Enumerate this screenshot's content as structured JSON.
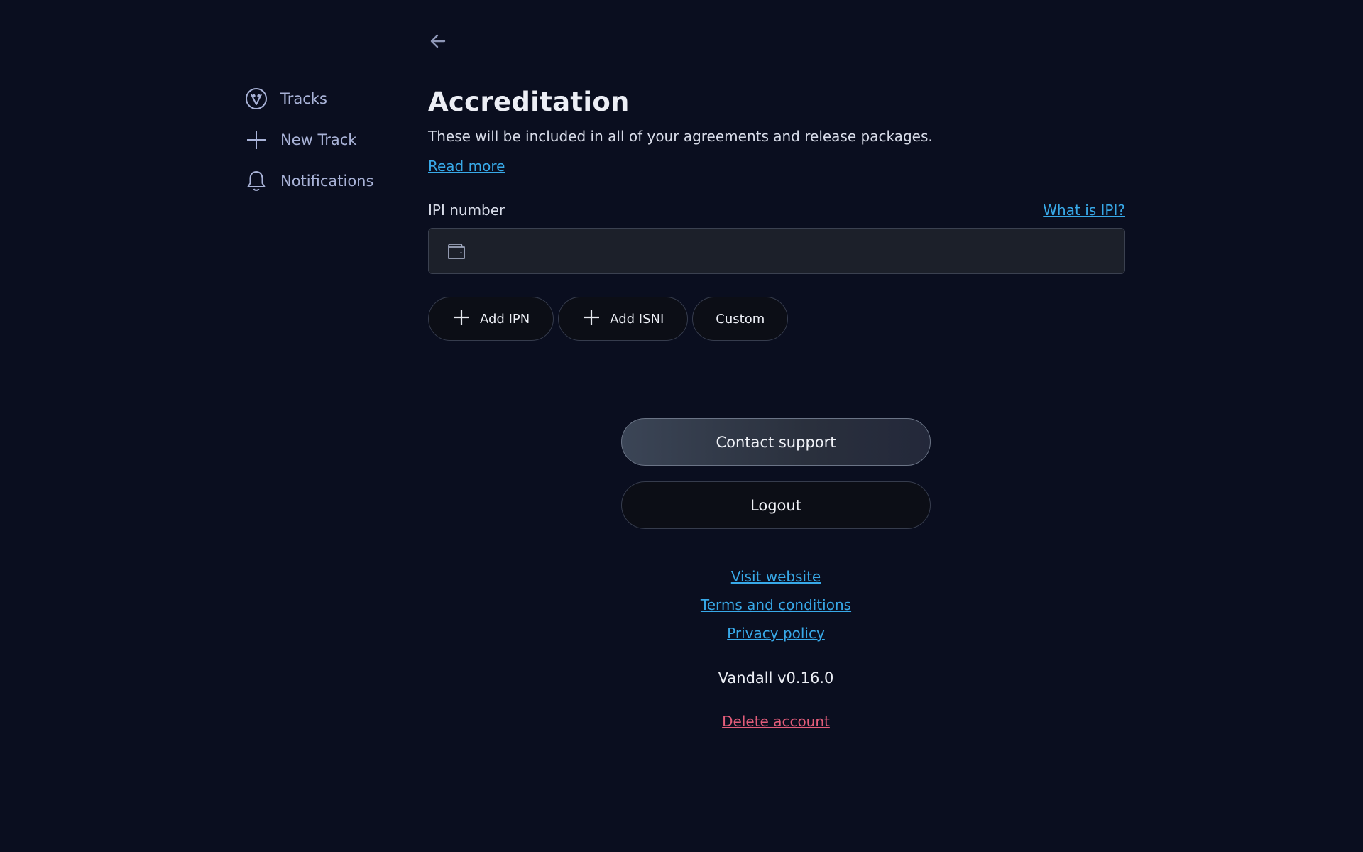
{
  "sidebar": {
    "items": [
      {
        "label": "Tracks",
        "icon": "vandall-logo-icon"
      },
      {
        "label": "New Track",
        "icon": "plus-icon"
      },
      {
        "label": "Notifications",
        "icon": "bell-icon"
      }
    ]
  },
  "header": {
    "back_icon": "arrow-left-icon",
    "title": "Accreditation",
    "subtitle": "These will be included in all of your agreements and release packages.",
    "read_more": "Read more"
  },
  "ipi": {
    "label": "IPI number",
    "help_link": "What is IPI?",
    "value": "",
    "placeholder": "",
    "icon": "wallet-icon"
  },
  "chips": [
    {
      "label": "Add IPN",
      "icon": "plus-icon"
    },
    {
      "label": "Add ISNI",
      "icon": "plus-icon"
    },
    {
      "label": "Custom"
    }
  ],
  "actions": {
    "contact_support": "Contact support",
    "logout": "Logout"
  },
  "footer": {
    "visit_website": "Visit website",
    "terms": "Terms and conditions",
    "privacy": "Privacy policy",
    "version": "Vandall v0.16.0",
    "delete_account": "Delete account"
  },
  "colors": {
    "background": "#0a0e1f",
    "link": "#38a9e8",
    "danger": "#e35d7a",
    "nav_text": "#a9b3d8"
  }
}
